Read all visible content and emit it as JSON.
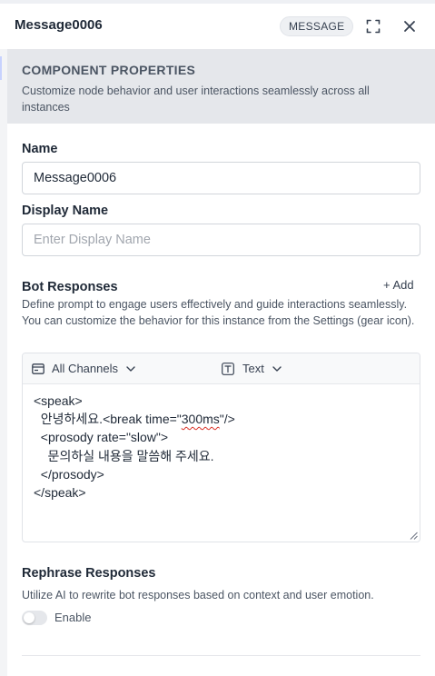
{
  "header": {
    "title": "Message0006",
    "badge": "MESSAGE"
  },
  "properties": {
    "title": "COMPONENT PROPERTIES",
    "description": "Customize node behavior and user interactions seamlessly across all instances"
  },
  "name_field": {
    "label": "Name",
    "value": "Message0006"
  },
  "display_name_field": {
    "label": "Display Name",
    "value": "",
    "placeholder": "Enter Display Name"
  },
  "bot_responses": {
    "label": "Bot Responses",
    "add_label": "+ Add",
    "description": "Define prompt to engage users effectively and guide interactions seamlessly. You can customize the behavior for this instance from the Settings (gear icon).",
    "channel_selector": "All Channels",
    "format_selector": "Text",
    "code_lines": [
      "<speak>",
      "  안녕하세요.<break time=\"",
      "300ms",
      "\"/>",
      "  <prosody rate=\"slow\">",
      "    문의하실 내용을 말씀해 주세요.",
      "  </prosody>",
      "</speak>"
    ]
  },
  "rephrase": {
    "label": "Rephrase Responses",
    "description": "Utilize AI to rewrite bot responses based on context and user emotion.",
    "toggle_label": "Enable",
    "enabled": false
  },
  "icons": {
    "expand": "expand-icon",
    "close": "close-icon",
    "channels": "channels-card-icon",
    "chevron": "chevron-down-icon",
    "text_format": "text-format-icon",
    "plus": "plus-icon",
    "resize": "resize-handle-icon"
  },
  "colors": {
    "banner_bg": "#e5e7eb",
    "badge_bg": "#eef0f3",
    "spellcheck": "#d93025"
  }
}
